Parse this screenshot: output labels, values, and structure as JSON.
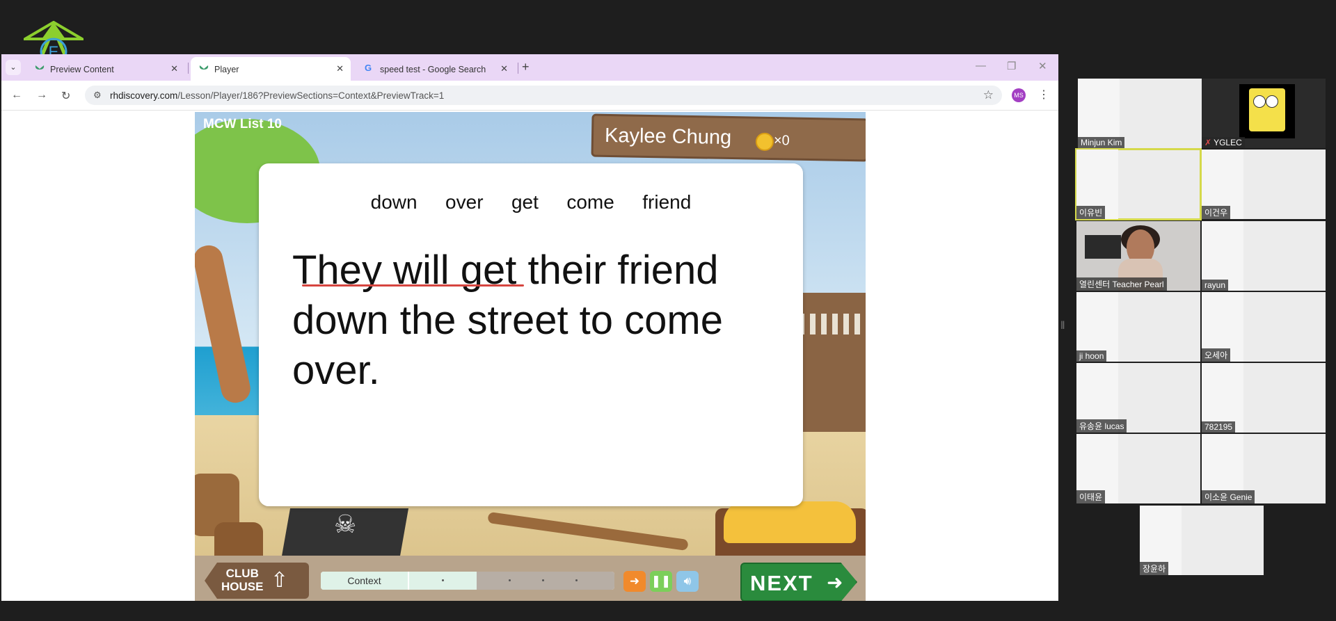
{
  "browser": {
    "tabs": [
      {
        "title": "Preview Content",
        "active": false
      },
      {
        "title": "Player",
        "active": true
      },
      {
        "title": "speed test - Google Search",
        "active": false
      }
    ],
    "url_host": "rhdiscovery.com",
    "url_path": "/Lesson/Player/186?PreviewSections=Context&PreviewTrack=1",
    "profile_initials": "MS"
  },
  "game": {
    "list_label": "MCW List 10",
    "player_name": "Kaylee Chung",
    "coin_count": "×0",
    "word_bank": [
      "down",
      "over",
      "get",
      "come",
      "friend"
    ],
    "sentence": "They will get their friend down the street to come over.",
    "clubhouse_label_line1": "CLUB",
    "clubhouse_label_line2": "HOUSE",
    "progress_label": "Context",
    "progress_fraction": 0.53,
    "next_label": "NEXT"
  },
  "colors": {
    "tabbar": "#ead7f6",
    "next_button": "#2a8b3d",
    "underline": "#d6453f",
    "profile": "#a33fc3",
    "active_speaker_outline": "#d5d94a"
  },
  "participants": [
    {
      "name": "Minjun Kim"
    },
    {
      "name": "YGLEC",
      "muted": true
    },
    {
      "name": "이유빈",
      "active": true
    },
    {
      "name": "이건우"
    },
    {
      "name": "열린센터  Teacher Pearl"
    },
    {
      "name": "rayun"
    },
    {
      "name": "ji hoon"
    },
    {
      "name": "오세아"
    },
    {
      "name": "유송윤  lucas"
    },
    {
      "name": "782195"
    },
    {
      "name": "이태윤"
    },
    {
      "name": "이소윤  Genie"
    },
    {
      "name": "장윤하"
    }
  ]
}
